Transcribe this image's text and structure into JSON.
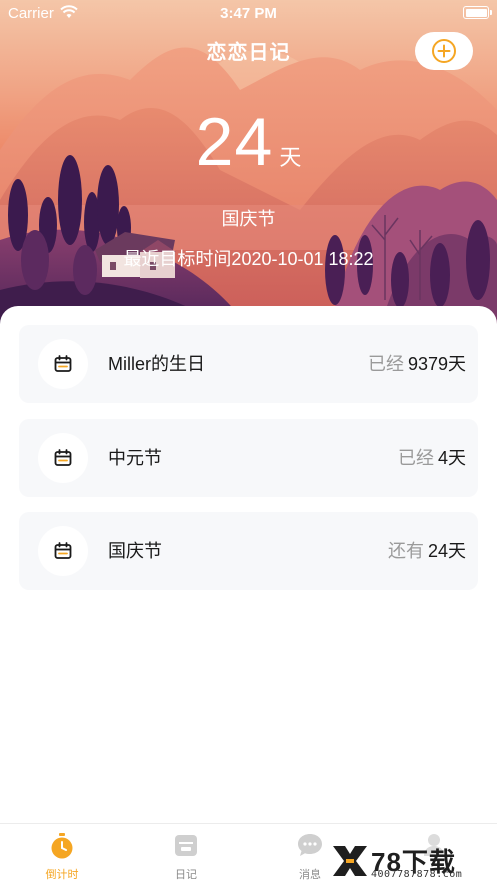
{
  "status_bar": {
    "carrier": "Carrier",
    "time": "3:47 PM"
  },
  "nav": {
    "title": "恋恋日记",
    "add_icon": "plus-circle-icon"
  },
  "countdown": {
    "number": "24",
    "unit": "天",
    "name": "国庆节",
    "target_time": "最近目标时间2020-10-01 18:22"
  },
  "events": [
    {
      "name": "Miller的生日",
      "prefix": "已经",
      "days": "9379天",
      "icon": "calendar-icon"
    },
    {
      "name": "中元节",
      "prefix": "已经",
      "days": "4天",
      "icon": "calendar-icon"
    },
    {
      "name": "国庆节",
      "prefix": "还有",
      "days": "24天",
      "icon": "calendar-icon"
    }
  ],
  "tabs": [
    {
      "label": "倒计时",
      "icon": "stopwatch-icon",
      "active": true
    },
    {
      "label": "日记",
      "icon": "diary-icon",
      "active": false
    },
    {
      "label": "消息",
      "icon": "message-icon",
      "active": false
    },
    {
      "label": "",
      "icon": "profile-icon",
      "active": false
    }
  ],
  "watermark": {
    "main": "78下载",
    "sub": "4007787878.com"
  },
  "colors": {
    "accent": "#f5a623",
    "card_bg": "#f7f8fa",
    "hero_top": "#f4c6a8",
    "hero_bottom": "#7d3d6c"
  }
}
